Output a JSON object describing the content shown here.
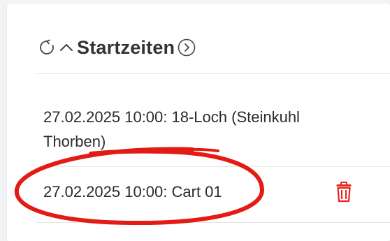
{
  "panel": {
    "title": "Startzeiten",
    "icons": {
      "refresh": "refresh-icon",
      "collapse": "chevron-up-icon",
      "navigate": "chevron-right-circle-icon"
    },
    "entries": [
      {
        "text": "27.02.2025 10:00: 18-Loch (Steinkuhl Thorben)"
      },
      {
        "text": "27.02.2025 10:00: Cart 01",
        "delete_icon": "trash-icon"
      }
    ]
  },
  "colors": {
    "accent_red": "#e8231c",
    "text": "#2a2a2a",
    "divider": "#e6e6e6",
    "background": "#f3f3f4"
  }
}
